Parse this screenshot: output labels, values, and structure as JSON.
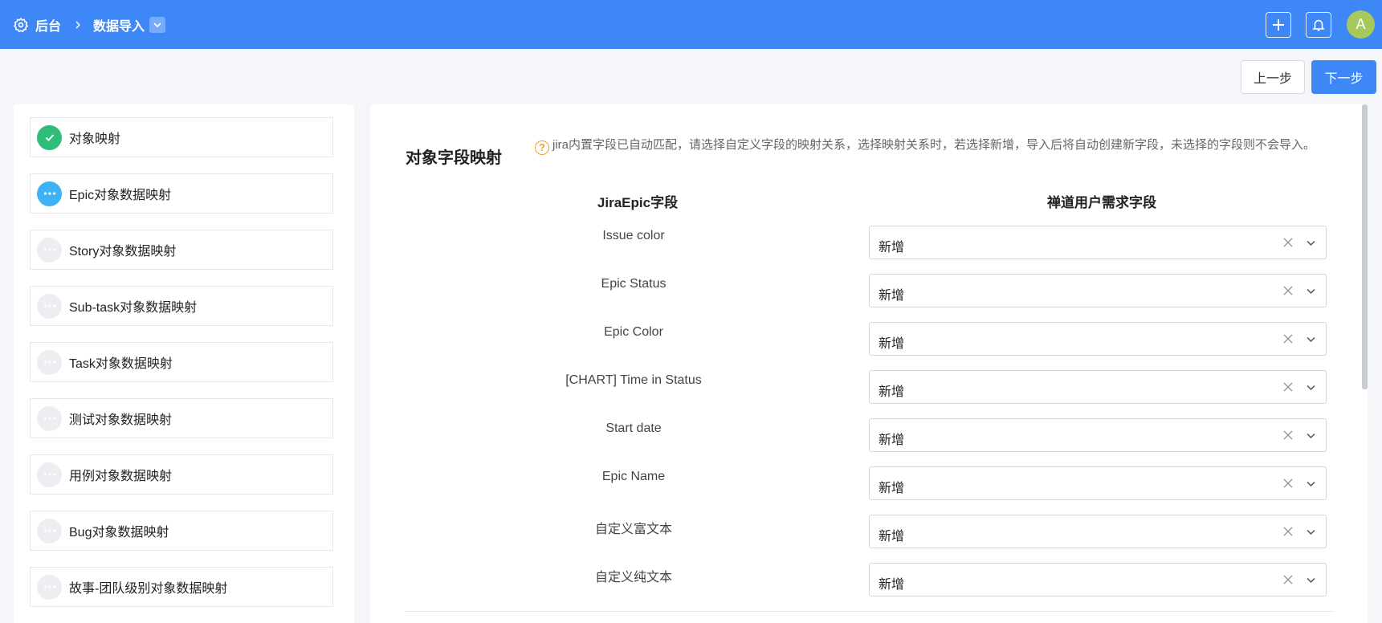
{
  "header": {
    "icon": "gear-icon",
    "breadcrumb_root": "后台",
    "breadcrumb_current": "数据导入",
    "actions": [
      "plus-icon",
      "bell-icon"
    ],
    "avatar_letter": "A",
    "colors": {
      "bar": "#3d87f6",
      "avatar": "#a6c95e"
    }
  },
  "toolbar": {
    "prev_label": "上一步",
    "next_label": "下一步"
  },
  "steps": [
    {
      "label": "对象映射",
      "status": "done"
    },
    {
      "label": "Epic对象数据映射",
      "status": "active"
    },
    {
      "label": "Story对象数据映射",
      "status": "pending"
    },
    {
      "label": "Sub-task对象数据映射",
      "status": "pending"
    },
    {
      "label": "Task对象数据映射",
      "status": "pending"
    },
    {
      "label": "测试对象数据映射",
      "status": "pending"
    },
    {
      "label": "用例对象数据映射",
      "status": "pending"
    },
    {
      "label": "Bug对象数据映射",
      "status": "pending"
    },
    {
      "label": "故事-团队级别对象数据映射",
      "status": "pending"
    }
  ],
  "mapping": {
    "title": "对象字段映射",
    "tip_icon": "question-circle-icon",
    "tip": "jira内置字段已自动匹配，请选择自定义字段的映射关系，选择映射关系时，若选择新增，导入后将自动创建新字段，未选择的字段则不会导入。",
    "col_source": "JiraEpic字段",
    "col_target": "禅道用户需求字段",
    "rows": [
      {
        "field": "Issue color",
        "value": "新增"
      },
      {
        "field": "Epic Status",
        "value": "新增"
      },
      {
        "field": "Epic Color",
        "value": "新增"
      },
      {
        "field": "[CHART] Time in Status",
        "value": "新增"
      },
      {
        "field": "Start date",
        "value": "新增"
      },
      {
        "field": "Epic Name",
        "value": "新增"
      },
      {
        "field": "自定义富文本",
        "value": "新增"
      },
      {
        "field": "自定义纯文本",
        "value": "新增"
      }
    ]
  }
}
